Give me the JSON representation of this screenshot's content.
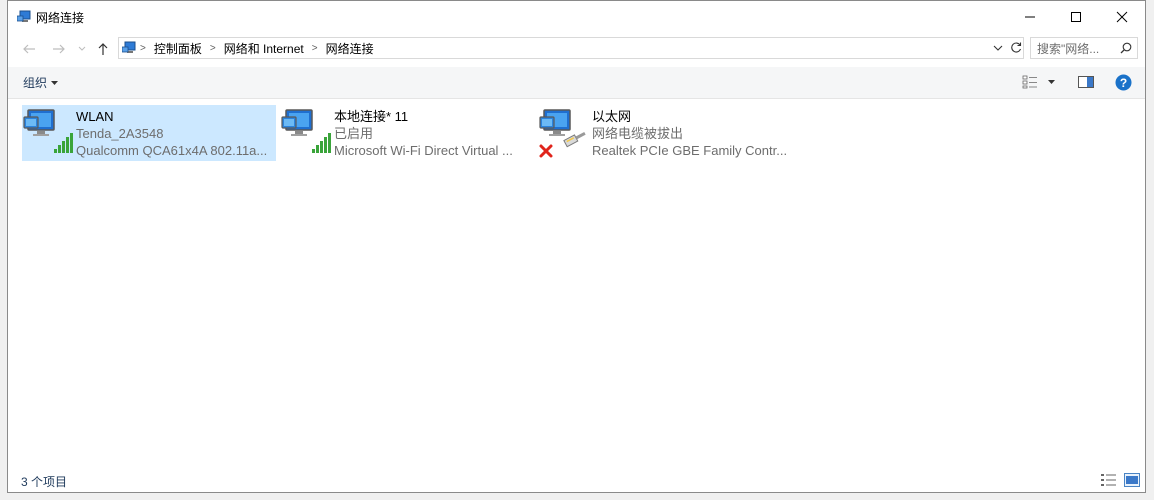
{
  "window": {
    "title": "网络连接",
    "controls": {
      "minimize": "minimize",
      "maximize": "maximize",
      "close": "close"
    }
  },
  "address": {
    "breadcrumbs": [
      "控制面板",
      "网络和 Internet",
      "网络连接"
    ],
    "search_placeholder": "搜索\"网络..."
  },
  "command_bar": {
    "organize_label": "组织"
  },
  "connections": [
    {
      "name": "WLAN",
      "status": "Tenda_2A3548",
      "adapter": "Qualcomm QCA61x4A 802.11a...",
      "type": "wifi",
      "selected": true
    },
    {
      "name": "本地连接* 11",
      "status": "已启用",
      "adapter": "Microsoft Wi-Fi Direct Virtual ...",
      "type": "wifi",
      "selected": false
    },
    {
      "name": "以太网",
      "status": "网络电缆被拔出",
      "adapter": "Realtek PCIe GBE Family Contr...",
      "type": "ethernet-disconnected",
      "selected": false
    }
  ],
  "status_bar": {
    "item_count": "3 个项目"
  },
  "colors": {
    "selection": "#cce8ff",
    "signal_green": "#3aa43a",
    "error_red": "#e0241b",
    "help_blue": "#1a72c9"
  }
}
